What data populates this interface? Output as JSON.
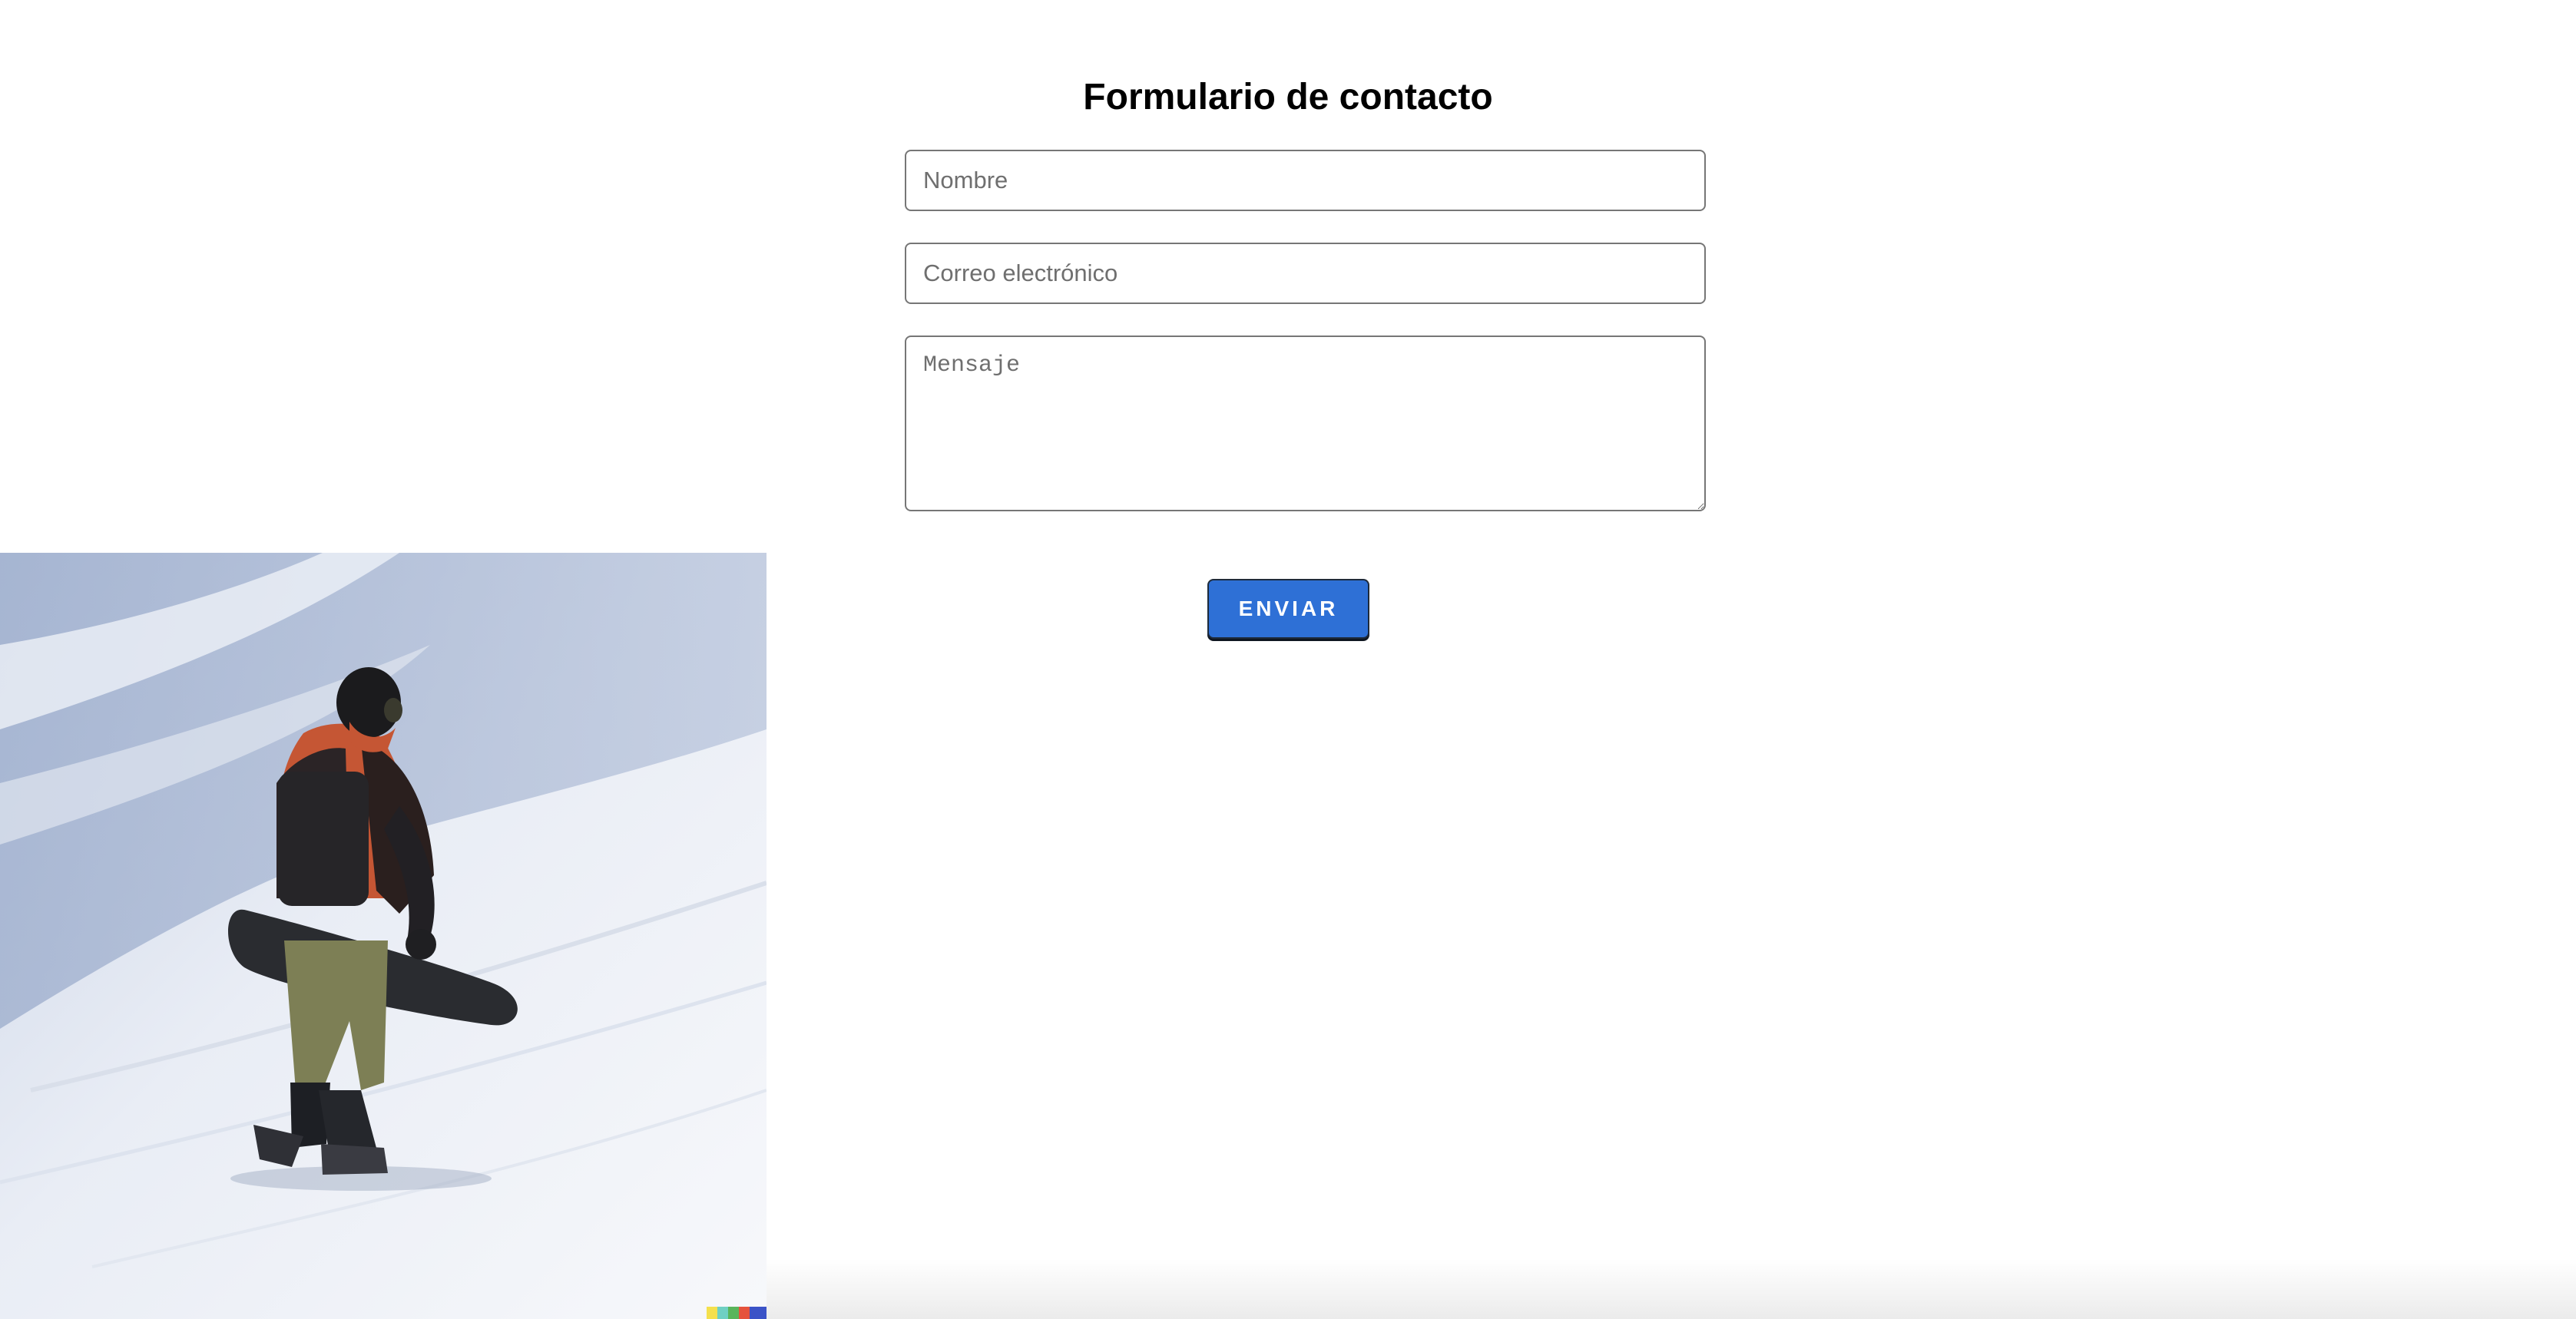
{
  "form": {
    "title": "Formulario de contacto",
    "name_placeholder": "Nombre",
    "email_placeholder": "Correo electrónico",
    "message_placeholder": "Mensaje",
    "submit_label": "ENVIAR"
  },
  "colors": {
    "accent": "#2e70d6",
    "field_border": "#767676",
    "background": "#ffffff"
  },
  "image": {
    "subject": "snowboarder-walking-on-snowy-slope"
  }
}
